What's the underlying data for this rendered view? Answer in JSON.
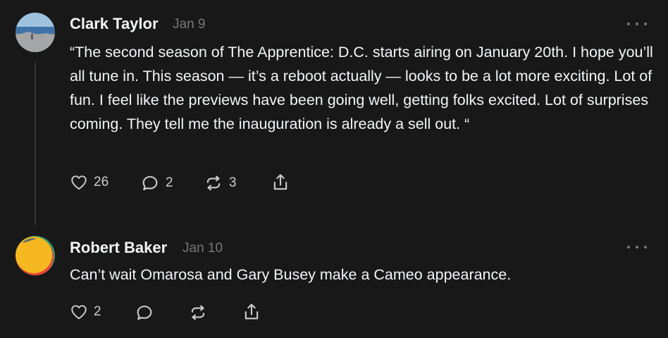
{
  "posts": [
    {
      "author": "Clark Taylor",
      "date": "Jan 9",
      "text": "“The second season of The Apprentice: D.C. starts airing on January 20th. I hope you’ll all tune in. This season — it’s a reboot actually — looks to be a lot more exciting. Lot of fun. I feel like the previews have been going well, getting folks excited. Lot of surprises coming. They tell me the inauguration is already a sell out. “",
      "likes": "26",
      "replies": "2",
      "reposts": "3"
    },
    {
      "author": "Robert Baker",
      "date": "Jan 10",
      "text": "Can’t wait Omarosa and Gary Busey make a Cameo appearance.",
      "likes": "2"
    }
  ],
  "colors": {
    "background": "#181818",
    "text_primary": "#f3f5f7",
    "text_secondary": "#777777",
    "icon": "#cccccc",
    "thread_line": "#333638"
  },
  "icons": {
    "like": "heart-icon",
    "reply": "comment-bubble-icon",
    "repost": "repost-icon",
    "share": "share-icon",
    "more": "more-dots-icon"
  }
}
